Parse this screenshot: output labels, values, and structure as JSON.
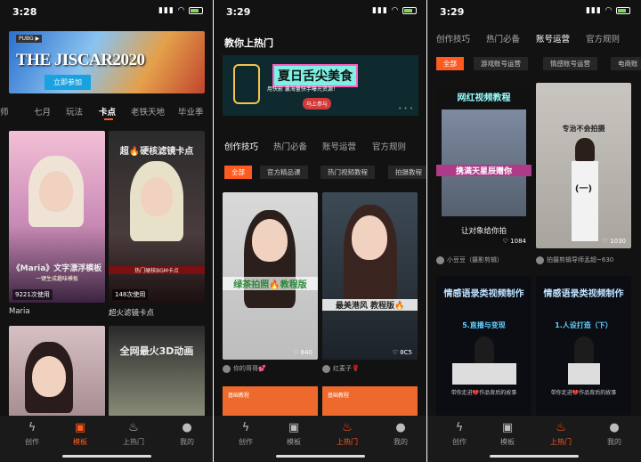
{
  "status": [
    {
      "time": "3:28"
    },
    {
      "time": "3:29"
    },
    {
      "time": "3:29"
    }
  ],
  "panel1": {
    "banner": {
      "logo": "PUBG ▶",
      "title": "THE JISCAR2020",
      "cta": "立即参加"
    },
    "tabs": [
      "师",
      "七月",
      "玩法",
      "卡点",
      "老铁天地",
      "毕业季"
    ],
    "active_tab": "卡点",
    "cards": [
      {
        "caption": "《Maria》文字漂浮模板",
        "sub": "一键生成趣味模板",
        "count": "9221次使用",
        "label": "Maria"
      },
      {
        "caption": "超🔥硬核滤镜卡点",
        "sub": "热门硬核BGM卡点",
        "count": "148次使用",
        "label": "超火滤镜卡点"
      },
      {
        "caption": "",
        "sub": "",
        "count": "",
        "label": ""
      },
      {
        "caption": "全网最火3D动画",
        "sub": "",
        "count": "",
        "label": ""
      }
    ]
  },
  "panel2": {
    "header": "教你上热门",
    "banner": {
      "title": "夏日舌尖美食",
      "sub": "用快影 赢海量快手曝光资源！",
      "btn": "马上参与"
    },
    "tabs": [
      "创作技巧",
      "热门必备",
      "账号运营",
      "官方规则"
    ],
    "chips": [
      "全部",
      "官方精品课",
      "热门视频教程",
      "拍摄教程"
    ],
    "cards": [
      {
        "caption": "绿茶拍照🔥教程版",
        "likes": "♡ 840",
        "author": "你的哥哥💕"
      },
      {
        "caption": "最美港风 教程版🔥",
        "likes": "♡ 8C5",
        "author": "红麦子🌹"
      }
    ],
    "orange": [
      {
        "t": "基础教程"
      },
      {
        "t": "基础教程"
      }
    ]
  },
  "panel3": {
    "tabs": [
      "创作技巧",
      "热门必备",
      "账号运营",
      "官方规则"
    ],
    "chips": [
      "全部",
      "游戏账号运营",
      "情感账号运营",
      "电商账"
    ],
    "cards": [
      {
        "title": "网红视频教程",
        "mid": "携满天星辰赠你",
        "bottom": "让对象给你拍",
        "likes": "♡ 1084",
        "author": "小豆豆（摄影剪辑）"
      },
      {
        "title": "专治不会拍摄",
        "mid": "(一)",
        "bottom": "",
        "likes": "♡ 1030",
        "author": "拍摄剪辑导师孟超~630"
      },
      {
        "title": "情感语录类视频制作",
        "mid": "5.直播与变现",
        "bottom": "带你走进💔作品背后的故事"
      },
      {
        "title": "情感语录类视频制作",
        "mid": "1.人设打造（下）",
        "bottom": "带你走进💔作品背后的故事"
      }
    ]
  },
  "nav": [
    "创作",
    "模板",
    "上热门",
    "我的"
  ],
  "active_nav": [
    1,
    2,
    2
  ],
  "nav_icons": [
    "flash-icon",
    "template-icon",
    "fire-icon",
    "person-icon"
  ]
}
